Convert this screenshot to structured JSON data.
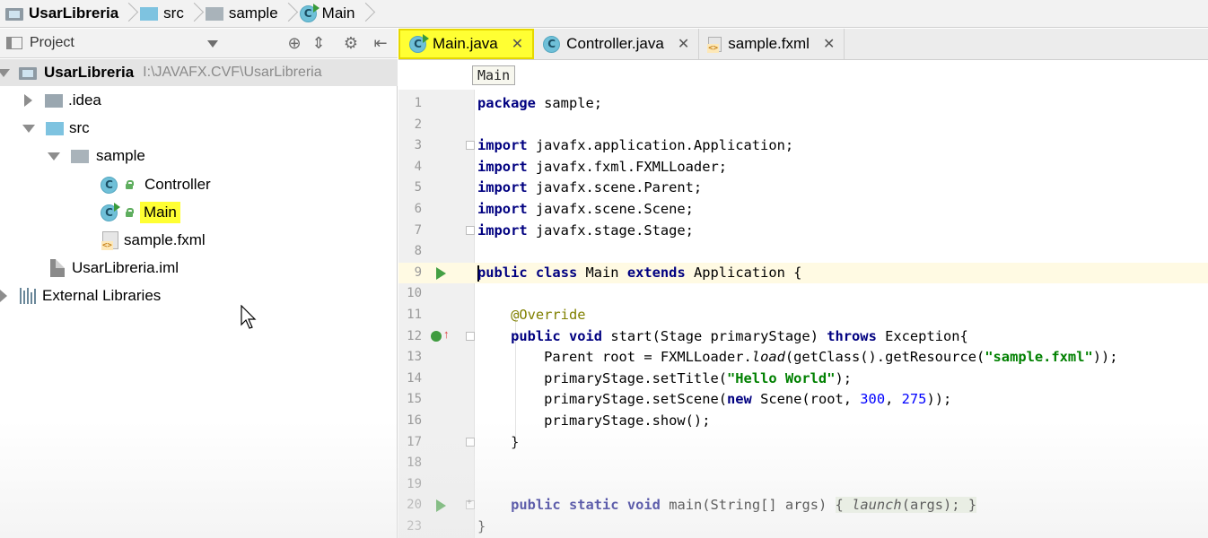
{
  "breadcrumb": {
    "items": [
      {
        "label": "UsarLibreria",
        "icon": "module-icon"
      },
      {
        "label": "src",
        "icon": "folder-icon"
      },
      {
        "label": "sample",
        "icon": "package-icon"
      },
      {
        "label": "Main",
        "icon": "class-icon"
      }
    ]
  },
  "project_panel": {
    "view_label": "Project",
    "tree": {
      "root": {
        "label": "UsarLibreria",
        "path": "I:\\JAVAFX.CVF\\UsarLibreria"
      },
      "idea": ".idea",
      "src": "src",
      "sample": "sample",
      "controller": "Controller",
      "main": "Main",
      "sample_fxml": "sample.fxml",
      "iml": "UsarLibreria.iml",
      "external": "External Libraries"
    }
  },
  "editor": {
    "tabs": [
      {
        "label": "Main.java",
        "active": true
      },
      {
        "label": "Controller.java",
        "active": false
      },
      {
        "label": "sample.fxml",
        "active": false
      }
    ],
    "tooltip": "Main",
    "line_numbers": [
      "1",
      "2",
      "3",
      "4",
      "5",
      "6",
      "7",
      "8",
      "9",
      "10",
      "11",
      "12",
      "13",
      "14",
      "15",
      "16",
      "17",
      "18",
      "19",
      "20",
      "23"
    ],
    "code": {
      "l1_kw": "package",
      "l1_rest": " sample;",
      "import_kw": "import",
      "l3": " javafx.application.Application;",
      "l4": " javafx.fxml.FXMLLoader;",
      "l5": " javafx.scene.Parent;",
      "l6": " javafx.scene.Scene;",
      "l7": " javafx.stage.Stage;",
      "l9_kw1": "public",
      "l9_kw2": "class",
      "l9_name": " Main ",
      "l9_kw3": "extends",
      "l9_rest": " Application {",
      "l11": "@Override",
      "l12_kw1": "public",
      "l12_kw2": "void",
      "l12_mid": " start(Stage primaryStage) ",
      "l12_kw3": "throws",
      "l12_rest": " Exception{",
      "l13_a": "Parent root = FXMLLoader.",
      "l13_b": "load",
      "l13_c": "(getClass().getResource(",
      "l13_str": "\"sample.fxml\"",
      "l13_d": "));",
      "l14_a": "primaryStage.setTitle(",
      "l14_str": "\"Hello World\"",
      "l14_b": ");",
      "l15_a": "primaryStage.setScene(",
      "l15_kw": "new",
      "l15_b": " Scene(root, ",
      "l15_n1": "300",
      "l15_c": ", ",
      "l15_n2": "275",
      "l15_d": "));",
      "l16": "primaryStage.show();",
      "l17": "}",
      "l20_kw1": "public",
      "l20_kw2": "static",
      "l20_kw3": "void",
      "l20_mid": " main(String[] args) ",
      "l20_b1": "{ ",
      "l20_launch": "launch",
      "l20_rest": "(args); ",
      "l20_b2": "}",
      "l23": "}"
    }
  },
  "colors": {
    "highlight": "#ffff33",
    "keyword": "#000080",
    "string": "#008000",
    "number": "#0000ff",
    "annotation": "#808000"
  }
}
